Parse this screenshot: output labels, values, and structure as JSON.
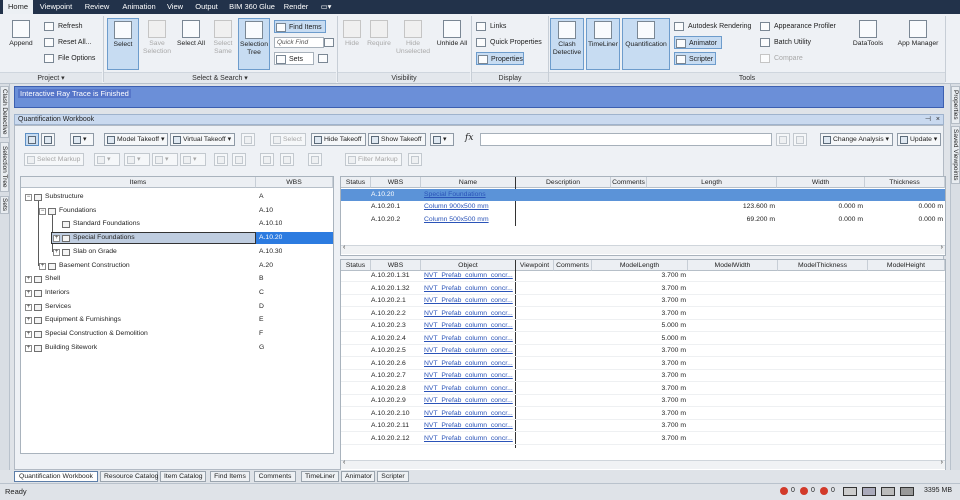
{
  "menu": {
    "tabs": [
      "Home",
      "Viewpoint",
      "Review",
      "Animation",
      "View",
      "Output",
      "BIM 360 Glue",
      "Render"
    ],
    "extra": "▭▾"
  },
  "ribbon": {
    "project": {
      "append": "Append",
      "refresh": "Refresh",
      "reset_all": "Reset All...",
      "file_options": "File Options",
      "label": "Project ▾"
    },
    "select": {
      "select": "Select",
      "save_selection": "Save Selection",
      "select_all": "Select All",
      "select_same": "Select Same",
      "selection_tree": "Selection Tree",
      "find_items": "Find Items",
      "quick_find_placeholder": "Quick Find",
      "sets": "Sets",
      "label": "Select & Search ▾"
    },
    "visibility": {
      "hide": "Hide",
      "require": "Require",
      "hide_unselected": "Hide Unselected",
      "unhide_all": "Unhide All",
      "label": "Visibility"
    },
    "display": {
      "links": "Links",
      "quick_properties": "Quick Properties",
      "properties": "Properties",
      "label": "Display"
    },
    "tools": {
      "clash_detective": "Clash Detective",
      "timeliner": "TimeLiner",
      "quantification": "Quantification",
      "autodesk_rendering": "Autodesk Rendering",
      "animator": "Animator",
      "scripter": "Scripter",
      "appearance_profiler": "Appearance Profiler",
      "batch_utility": "Batch Utility",
      "compare": "Compare",
      "datatools": "DataTools",
      "app_manager": "App Manager",
      "label": "Tools"
    }
  },
  "side_tabs_left": [
    "Clash Detective",
    "Selection Tree",
    "Sets"
  ],
  "side_tabs_right": [
    "Properties",
    "Saved Viewpoints"
  ],
  "notice": "Interactive Ray Trace is Finished",
  "workbook": {
    "title": "Quantification Workbook",
    "toolbar": {
      "model_takeoff": "Model Takeoff",
      "virtual_takeoff": "Virtual Takeoff",
      "select": "Select",
      "hide_takeoff": "Hide Takeoff",
      "show_takeoff": "Show Takeoff",
      "change_analysis": "Change Analysis",
      "update": "Update",
      "select_markup": "Select Markup",
      "filter_markup": "Filter Markup",
      "fx": "fx"
    },
    "tree": {
      "headers": [
        "Items",
        "WBS"
      ],
      "rows": [
        {
          "label": "Substructure",
          "wbs": "A"
        },
        {
          "label": "Foundations",
          "wbs": "A.10"
        },
        {
          "label": "Standard Foundations",
          "wbs": "A.10.10"
        },
        {
          "label": "Special Foundations",
          "wbs": "A.10.20"
        },
        {
          "label": "Slab on Grade",
          "wbs": "A.10.30"
        },
        {
          "label": "Basement Construction",
          "wbs": "A.20"
        },
        {
          "label": "Shell",
          "wbs": "B"
        },
        {
          "label": "Interiors",
          "wbs": "C"
        },
        {
          "label": "Services",
          "wbs": "D"
        },
        {
          "label": "Equipment & Furnishings",
          "wbs": "E"
        },
        {
          "label": "Special Construction & Demolition",
          "wbs": "F"
        },
        {
          "label": "Building Sitework",
          "wbs": "G"
        }
      ]
    },
    "items_table": {
      "headers": [
        "Status",
        "WBS",
        "Name",
        "Description",
        "Comments",
        "Length",
        "Width",
        "Thickness"
      ],
      "rows": [
        {
          "wbs": "A.10.20",
          "name": "Special Foundations",
          "length": "",
          "width": "",
          "thickness": ""
        },
        {
          "wbs": "A.10.20.1",
          "name": "Column 900x500 mm",
          "length": "123.600 m",
          "width": "0.000 m",
          "thickness": "0.000 m"
        },
        {
          "wbs": "A.10.20.2",
          "name": "Column 500x500 mm",
          "length": "69.200 m",
          "width": "0.000 m",
          "thickness": "0.000 m"
        }
      ]
    },
    "objects_table": {
      "headers": [
        "Status",
        "WBS",
        "Object",
        "Viewpoint",
        "Comments",
        "ModelLength",
        "ModelWidth",
        "ModelThickness",
        "ModelHeight"
      ],
      "rows": [
        {
          "wbs": "A.10.20.1.31",
          "object": "NVT_Prefab_column_concr...",
          "length": "3.700 m"
        },
        {
          "wbs": "A.10.20.1.32",
          "object": "NVT_Prefab_column_concr...",
          "length": "3.700 m"
        },
        {
          "wbs": "A.10.20.2.1",
          "object": "NVT_Prefab_column_concr...",
          "length": "3.700 m"
        },
        {
          "wbs": "A.10.20.2.2",
          "object": "NVT_Prefab_column_concr...",
          "length": "3.700 m"
        },
        {
          "wbs": "A.10.20.2.3",
          "object": "NVT_Prefab_column_concr...",
          "length": "5.000 m"
        },
        {
          "wbs": "A.10.20.2.4",
          "object": "NVT_Prefab_column_concr...",
          "length": "5.000 m"
        },
        {
          "wbs": "A.10.20.2.5",
          "object": "NVT_Prefab_column_concr...",
          "length": "3.700 m"
        },
        {
          "wbs": "A.10.20.2.6",
          "object": "NVT_Prefab_column_concr...",
          "length": "3.700 m"
        },
        {
          "wbs": "A.10.20.2.7",
          "object": "NVT_Prefab_column_concr...",
          "length": "3.700 m"
        },
        {
          "wbs": "A.10.20.2.8",
          "object": "NVT_Prefab_column_concr...",
          "length": "3.700 m"
        },
        {
          "wbs": "A.10.20.2.9",
          "object": "NVT_Prefab_column_concr...",
          "length": "3.700 m"
        },
        {
          "wbs": "A.10.20.2.10",
          "object": "NVT_Prefab_column_concr...",
          "length": "3.700 m"
        },
        {
          "wbs": "A.10.20.2.11",
          "object": "NVT_Prefab_column_concr...",
          "length": "3.700 m"
        },
        {
          "wbs": "A.10.20.2.12",
          "object": "NVT_Prefab_column_concr...",
          "length": "3.700 m"
        }
      ]
    }
  },
  "bottom_tabs": [
    "Quantification Workbook",
    "Resource Catalog",
    "Item Catalog",
    "Find Items",
    "Comments",
    "TimeLiner",
    "Animator",
    "Scripter"
  ],
  "status": {
    "text": "Ready",
    "c1": "0",
    "c2": "0",
    "c3": "0",
    "memory": "3395 MB"
  },
  "colors": {
    "menubar": "#22324a",
    "notice": "#6b8fd8",
    "selection": "#5b93d8",
    "link": "#2a53b8"
  }
}
